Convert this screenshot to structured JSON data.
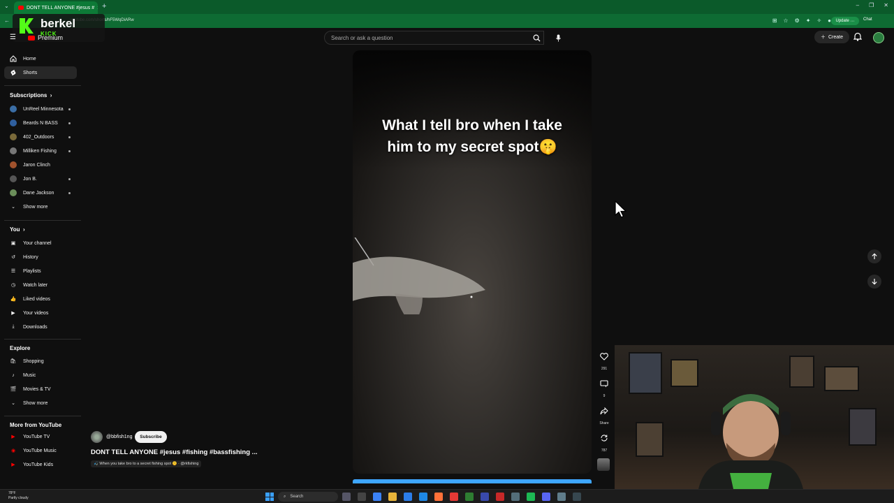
{
  "browser": {
    "tab_title": "DONT TELL ANYONE #jesus #",
    "tab_close": "×",
    "new_tab": "+",
    "url": "youtube.com/shorts/hF5WqDiARw",
    "update_label": "Update",
    "chat_label": "Chat",
    "window_controls": [
      "–",
      "❐",
      "✕"
    ]
  },
  "kick_overlay": {
    "name": "berkel",
    "platform": "KICK",
    "brand_color": "#53fc18"
  },
  "header": {
    "brand": "Premium",
    "search_placeholder": "Search or ask a question",
    "create_label": "Create"
  },
  "sidebar": {
    "main": [
      {
        "label": "Home",
        "icon": "home-icon"
      },
      {
        "label": "Shorts",
        "icon": "shorts-icon",
        "active": true
      }
    ],
    "subscriptions_heading": "Subscriptions",
    "subscriptions": [
      {
        "label": "UnReel Minnesota",
        "color": "#3b6ea5"
      },
      {
        "label": "Beards N BASS",
        "color": "#2f5f9e"
      },
      {
        "label": "402_Outdoors",
        "color": "#7a6a3a"
      },
      {
        "label": "Milliken Fishing",
        "color": "#777"
      },
      {
        "label": "Jaron Clinch",
        "color": "#a0522d"
      },
      {
        "label": "Jon B.",
        "color": "#555"
      },
      {
        "label": "Dane Jackson",
        "color": "#6b8e5a"
      }
    ],
    "subs_show_more": "Show more",
    "you_heading": "You",
    "you": [
      {
        "label": "Your channel",
        "icon": "channel-icon"
      },
      {
        "label": "History",
        "icon": "history-icon"
      },
      {
        "label": "Playlists",
        "icon": "playlists-icon"
      },
      {
        "label": "Watch later",
        "icon": "watch-later-icon"
      },
      {
        "label": "Liked videos",
        "icon": "like-icon"
      },
      {
        "label": "Your videos",
        "icon": "your-videos-icon"
      },
      {
        "label": "Downloads",
        "icon": "download-icon"
      }
    ],
    "explore_heading": "Explore",
    "explore": [
      {
        "label": "Shopping",
        "icon": "shopping-icon"
      },
      {
        "label": "Music",
        "icon": "music-icon"
      },
      {
        "label": "Movies & TV",
        "icon": "movies-icon"
      }
    ],
    "explore_show_more": "Show more",
    "more_heading": "More from YouTube",
    "more": [
      {
        "label": "YouTube TV"
      },
      {
        "label": "YouTube Music"
      },
      {
        "label": "YouTube Kids"
      }
    ]
  },
  "short": {
    "caption_line1": "What I tell bro when I take",
    "caption_line2": "him to my secret spot🤫",
    "channel": "@bbfish1ng",
    "subscribe_label": "Subscribe",
    "title": "DONT TELL ANYONE #jesus #fishing #bassfishing ...",
    "subtitle": "🎣 When you take bro to a secret fishing spot 🤫 · @rkfishing",
    "likes": "291",
    "comments": "9",
    "share_label": "Share",
    "remix_count": "787"
  },
  "taskbar": {
    "weather_temp": "78°F",
    "weather_desc": "Partly cloudy",
    "search_label": "Search"
  }
}
